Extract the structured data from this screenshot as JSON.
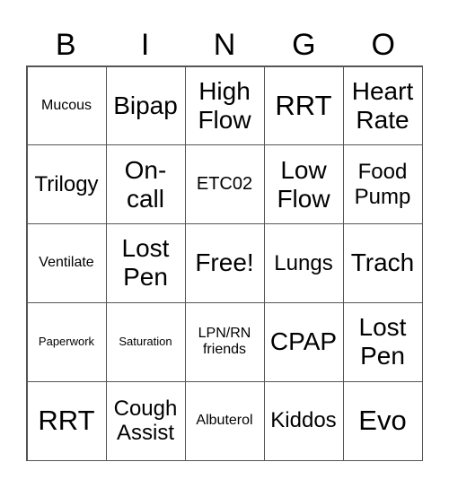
{
  "header": [
    "B",
    "I",
    "N",
    "G",
    "O"
  ],
  "cells": [
    {
      "text": "Mucous",
      "size": "s2"
    },
    {
      "text": "Bipap",
      "size": "s5"
    },
    {
      "text": "High Flow",
      "size": "s5"
    },
    {
      "text": "RRT",
      "size": "s6"
    },
    {
      "text": "Heart Rate",
      "size": "s5"
    },
    {
      "text": "Trilogy",
      "size": "s4"
    },
    {
      "text": "On-call",
      "size": "s5"
    },
    {
      "text": "ETC02",
      "size": "s3"
    },
    {
      "text": "Low Flow",
      "size": "s5"
    },
    {
      "text": "Food Pump",
      "size": "s4"
    },
    {
      "text": "Ventilate",
      "size": "s2"
    },
    {
      "text": "Lost Pen",
      "size": "s5"
    },
    {
      "text": "Free!",
      "size": "s5"
    },
    {
      "text": "Lungs",
      "size": "s4"
    },
    {
      "text": "Trach",
      "size": "s5"
    },
    {
      "text": "Paperwork",
      "size": "s1"
    },
    {
      "text": "Saturation",
      "size": "s1"
    },
    {
      "text": "LPN/RN friends",
      "size": "s2"
    },
    {
      "text": "CPAP",
      "size": "s5"
    },
    {
      "text": "Lost Pen",
      "size": "s5"
    },
    {
      "text": "RRT",
      "size": "s6"
    },
    {
      "text": "Cough Assist",
      "size": "s4"
    },
    {
      "text": "Albuterol",
      "size": "s2"
    },
    {
      "text": "Kiddos",
      "size": "s4"
    },
    {
      "text": "Evo",
      "size": "s6"
    }
  ]
}
